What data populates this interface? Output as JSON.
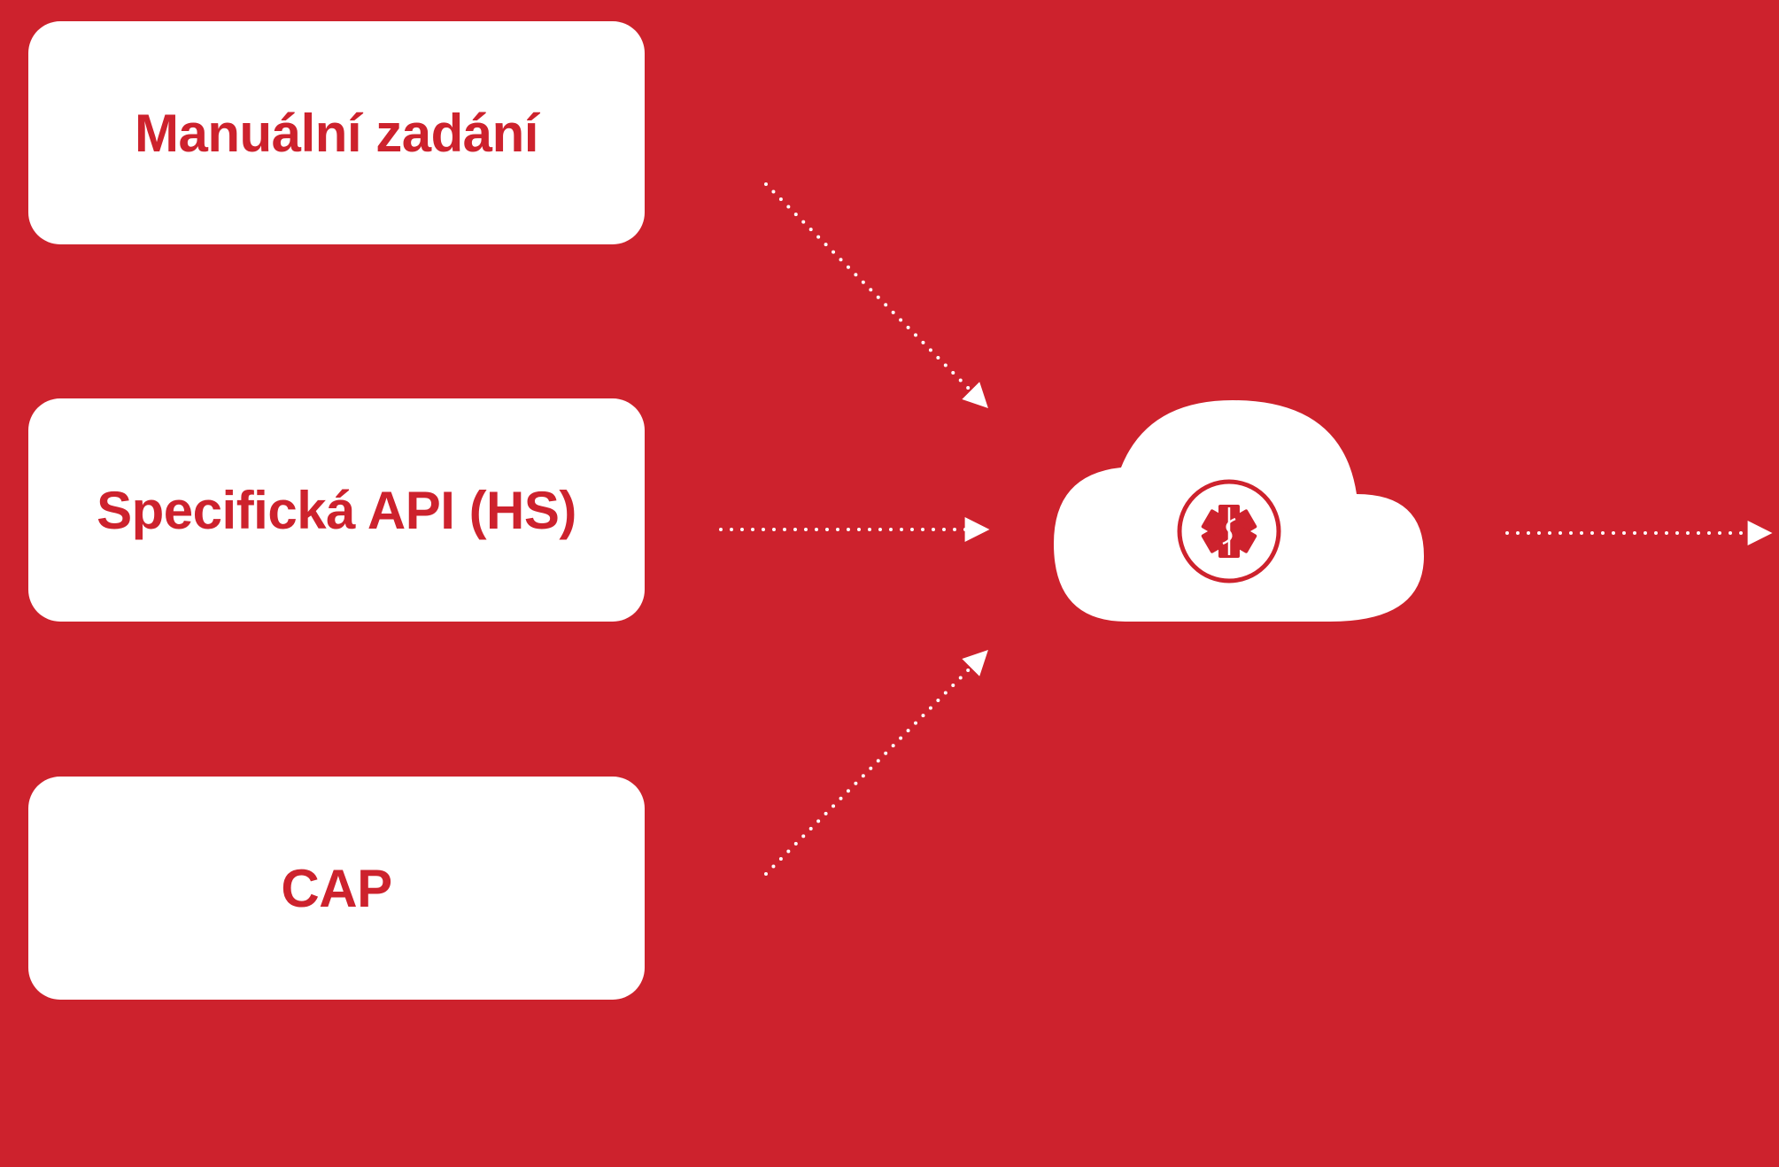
{
  "sources": [
    {
      "label": "Manuální zadání"
    },
    {
      "label": "Specifická API (HS)"
    },
    {
      "label": "CAP"
    }
  ],
  "hub": {
    "icon": "star-of-life-icon",
    "shape": "cloud-icon"
  },
  "colors": {
    "background": "#cd222d",
    "box": "#ffffff",
    "text": "#cd222d"
  }
}
